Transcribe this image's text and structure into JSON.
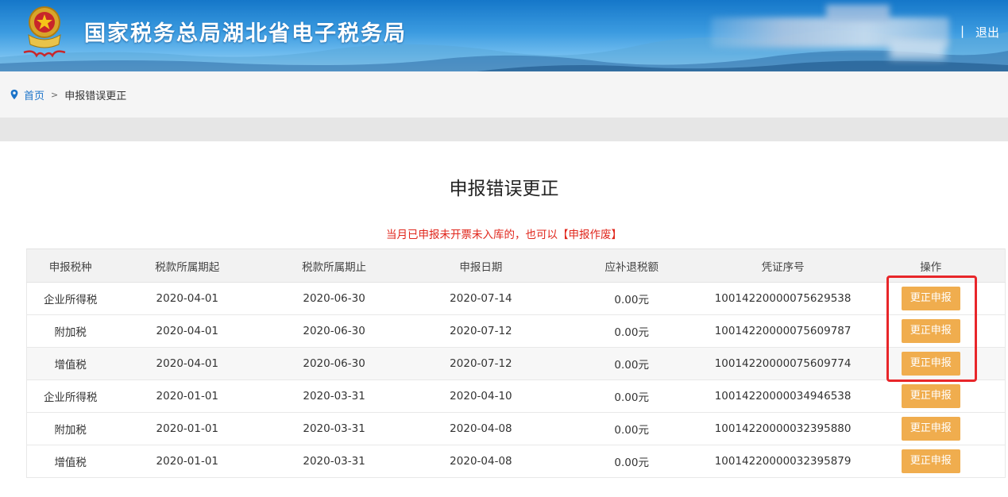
{
  "header": {
    "site_title": "国家税务总局湖北省电子税务局",
    "separator": "|",
    "logout_label": "退出",
    "brand_color": "#1577c9"
  },
  "breadcrumb": {
    "home": "首页",
    "separator": ">",
    "current": "申报错误更正"
  },
  "main": {
    "title": "申报错误更正",
    "notice": "当月已申报未开票未入库的，也可以",
    "notice_link": "【申报作废】",
    "notice_color": "#e0261b"
  },
  "table": {
    "columns": [
      "申报税种",
      "税款所属期起",
      "税款所属期止",
      "申报日期",
      "应补退税额",
      "凭证序号",
      "操作"
    ],
    "rows": [
      {
        "tax_type": "企业所得税",
        "period_start": "2020-04-01",
        "period_end": "2020-06-30",
        "declare_date": "2020-07-14",
        "amount": "0.00元",
        "voucher_no": "10014220000075629538",
        "action": "更正申报"
      },
      {
        "tax_type": "附加税",
        "period_start": "2020-04-01",
        "period_end": "2020-06-30",
        "declare_date": "2020-07-12",
        "amount": "0.00元",
        "voucher_no": "10014220000075609787",
        "action": "更正申报"
      },
      {
        "tax_type": "增值税",
        "period_start": "2020-04-01",
        "period_end": "2020-06-30",
        "declare_date": "2020-07-12",
        "amount": "0.00元",
        "voucher_no": "10014220000075609774",
        "action": "更正申报"
      },
      {
        "tax_type": "企业所得税",
        "period_start": "2020-01-01",
        "period_end": "2020-03-31",
        "declare_date": "2020-04-10",
        "amount": "0.00元",
        "voucher_no": "10014220000034946538",
        "action": "更正申报"
      },
      {
        "tax_type": "附加税",
        "period_start": "2020-01-01",
        "period_end": "2020-03-31",
        "declare_date": "2020-04-08",
        "amount": "0.00元",
        "voucher_no": "10014220000032395880",
        "action": "更正申报"
      },
      {
        "tax_type": "增值税",
        "period_start": "2020-01-01",
        "period_end": "2020-03-31",
        "declare_date": "2020-04-08",
        "amount": "0.00元",
        "voucher_no": "10014220000032395879",
        "action": "更正申报"
      }
    ],
    "action_color": "#f0ad4e",
    "highlight_color": "#e8262a"
  }
}
